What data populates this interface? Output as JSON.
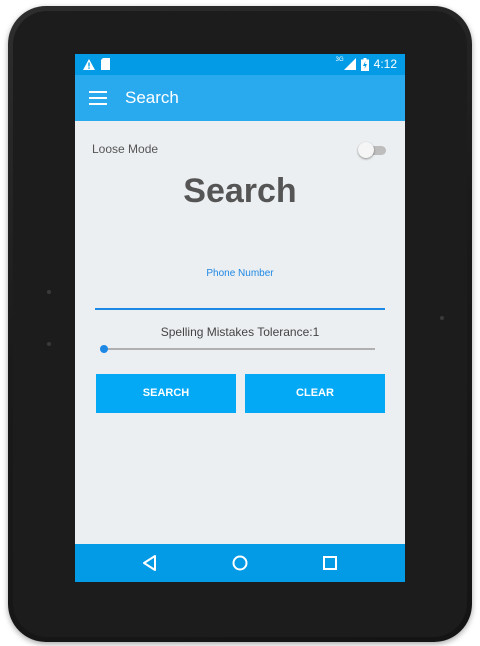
{
  "status_bar": {
    "network": "3G",
    "time": "4:12",
    "icons": [
      "warning-icon",
      "sd-card-icon",
      "signal-icon",
      "battery-icon"
    ]
  },
  "toolbar": {
    "title": "Search",
    "menu_icon": "hamburger-menu-icon"
  },
  "loose_mode": {
    "label": "Loose Mode",
    "enabled": false
  },
  "main": {
    "title": "Search",
    "phone_field": {
      "label": "Phone Number",
      "value": ""
    },
    "tolerance": {
      "label": "Spelling Mistakes Tolerance:1",
      "value": 1
    },
    "search_button_label": "SEARCH",
    "clear_button_label": "CLEAR"
  },
  "nav_bar": {
    "buttons": [
      "back-icon",
      "home-icon",
      "recents-icon"
    ]
  },
  "colors": {
    "status_bar": "#039be5",
    "toolbar": "#29a9ee",
    "accent": "#1e88e5",
    "button": "#03a9f4",
    "background": "#eceff1"
  }
}
